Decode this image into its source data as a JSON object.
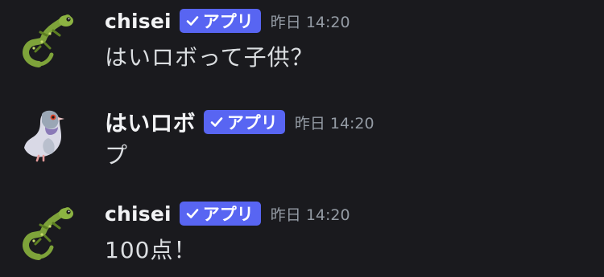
{
  "messages": [
    {
      "username": "chisei",
      "badge": "アプリ",
      "timestamp": "昨日 14:20",
      "content": "はいロボって子供？",
      "avatar": "lizard-avatar-icon"
    },
    {
      "username": "はいロボ",
      "badge": "アプリ",
      "timestamp": "昨日 14:20",
      "content": "プ",
      "avatar": "pigeon-avatar-icon"
    },
    {
      "username": "chisei",
      "badge": "アプリ",
      "timestamp": "昨日 14:20",
      "content": "100点！",
      "avatar": "lizard-avatar-icon"
    }
  ],
  "colors": {
    "background": "#1a1a1e",
    "badge": "#5865f2",
    "username": "#f2f3f5",
    "message": "#dbdee1",
    "timestamp": "#949ba4"
  }
}
